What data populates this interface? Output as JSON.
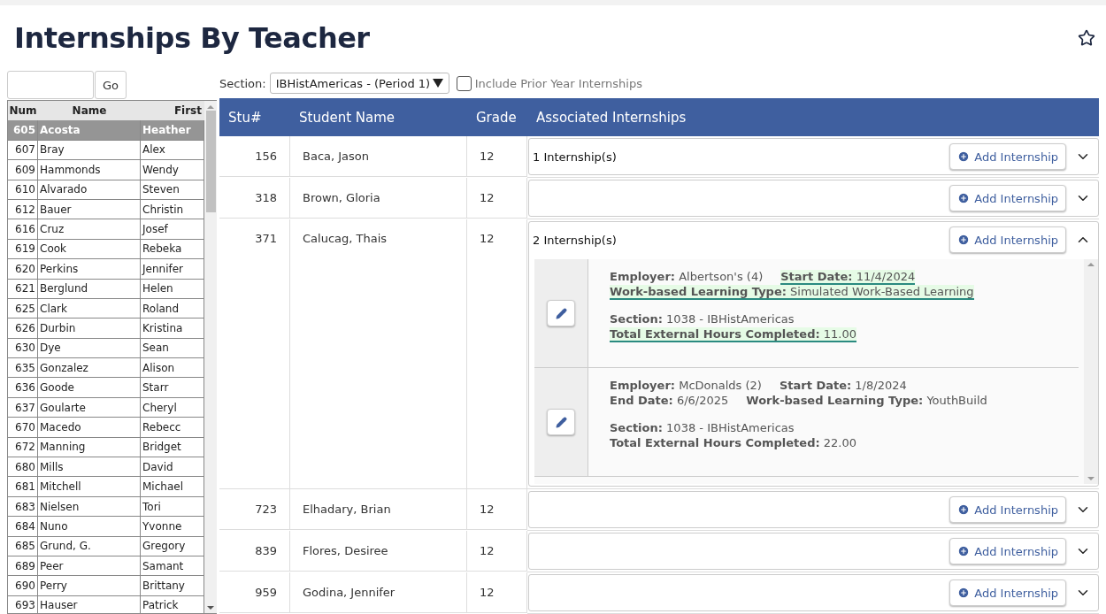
{
  "title": "Internships By Teacher",
  "favorite": false,
  "search": {
    "button": "Go"
  },
  "teacher_list": {
    "columns": [
      "Num",
      "Name",
      "First"
    ],
    "rows": [
      {
        "num": "605",
        "name": "Acosta",
        "first": "Heather",
        "selected": true
      },
      {
        "num": "607",
        "name": "Bray",
        "first": "Alex",
        "selected": false
      },
      {
        "num": "609",
        "name": "Hammonds",
        "first": "Wendy",
        "selected": false
      },
      {
        "num": "610",
        "name": "Alvarado",
        "first": "Steven",
        "selected": false
      },
      {
        "num": "612",
        "name": "Bauer",
        "first": "Christin",
        "selected": false
      },
      {
        "num": "616",
        "name": "Cruz",
        "first": "Josef",
        "selected": false
      },
      {
        "num": "619",
        "name": "Cook",
        "first": "Rebeka",
        "selected": false
      },
      {
        "num": "620",
        "name": "Perkins",
        "first": "Jennifer",
        "selected": false
      },
      {
        "num": "621",
        "name": "Berglund",
        "first": "Helen",
        "selected": false
      },
      {
        "num": "625",
        "name": "Clark",
        "first": "Roland",
        "selected": false
      },
      {
        "num": "626",
        "name": "Durbin",
        "first": "Kristina",
        "selected": false
      },
      {
        "num": "630",
        "name": "Dye",
        "first": "Sean",
        "selected": false
      },
      {
        "num": "635",
        "name": "Gonzalez",
        "first": "Alison",
        "selected": false
      },
      {
        "num": "636",
        "name": "Goode",
        "first": "Starr",
        "selected": false
      },
      {
        "num": "637",
        "name": "Goularte",
        "first": "Cheryl",
        "selected": false
      },
      {
        "num": "670",
        "name": "Macedo",
        "first": "Rebecc",
        "selected": false
      },
      {
        "num": "672",
        "name": "Manning",
        "first": "Bridget",
        "selected": false
      },
      {
        "num": "680",
        "name": "Mills",
        "first": "David",
        "selected": false
      },
      {
        "num": "681",
        "name": "Mitchell",
        "first": "Michael",
        "selected": false
      },
      {
        "num": "683",
        "name": "Nielsen",
        "first": "Tori",
        "selected": false
      },
      {
        "num": "684",
        "name": "Nuno",
        "first": "Yvonne",
        "selected": false
      },
      {
        "num": "685",
        "name": "Grund, G.",
        "first": "Gregory",
        "selected": false
      },
      {
        "num": "689",
        "name": "Peer",
        "first": "Samant",
        "selected": false
      },
      {
        "num": "690",
        "name": "Perry",
        "first": "Brittany",
        "selected": false
      },
      {
        "num": "693",
        "name": "Hauser",
        "first": "Patrick",
        "selected": false
      }
    ]
  },
  "section_filter": {
    "label": "Section:",
    "value": "IBHistAmericas - (Period 1)"
  },
  "prior_year": {
    "label": "Include Prior Year Internships",
    "checked": false
  },
  "students": {
    "columns": [
      "Stu#",
      "Student Name",
      "Grade",
      "Associated Internships"
    ],
    "rows": [
      {
        "num": "156",
        "name": "Baca, Jason",
        "grade": "12",
        "count": "1 Internship(s)",
        "add": "Add Internship",
        "expanded": false
      },
      {
        "num": "318",
        "name": "Brown, Gloria",
        "grade": "12",
        "add": "Add Internship",
        "expanded": false
      },
      {
        "num": "371",
        "name": "Calucag, Thais",
        "grade": "12",
        "count": "2 Internship(s)",
        "add": "Add Internship",
        "expanded": true,
        "internships": [
          {
            "groups": [
              [
                [
                  {
                    "label": "Employer:",
                    "value": "Albertson's (4)",
                    "highlighted": false
                  },
                  {
                    "label": "Start Date:",
                    "value": "11/4/2024",
                    "highlighted": true
                  }
                ],
                [
                  {
                    "label": "Work-based Learning Type:",
                    "value": "Simulated Work-Based Learning",
                    "highlighted": true
                  }
                ]
              ],
              [
                [
                  {
                    "label": "Section:",
                    "value": "1038 - IBHistAmericas",
                    "highlighted": false
                  }
                ],
                [
                  {
                    "label": "Total External Hours Completed:",
                    "value": "11.00",
                    "highlighted": true
                  }
                ]
              ]
            ]
          },
          {
            "groups": [
              [
                [
                  {
                    "label": "Employer:",
                    "value": "McDonalds (2)",
                    "highlighted": false
                  },
                  {
                    "label": "Start Date:",
                    "value": "1/8/2024",
                    "highlighted": false
                  }
                ],
                [
                  {
                    "label": "End Date:",
                    "value": "6/6/2025",
                    "highlighted": false
                  },
                  {
                    "label": "Work-based Learning Type:",
                    "value": "YouthBuild",
                    "highlighted": false
                  }
                ]
              ],
              [
                [
                  {
                    "label": "Section:",
                    "value": "1038 - IBHistAmericas",
                    "highlighted": false
                  }
                ],
                [
                  {
                    "label": "Total External Hours Completed:",
                    "value": "22.00",
                    "highlighted": false
                  }
                ]
              ]
            ]
          }
        ]
      },
      {
        "num": "723",
        "name": "Elhadary, Brian",
        "grade": "12",
        "add": "Add Internship",
        "expanded": false
      },
      {
        "num": "839",
        "name": "Flores, Desiree",
        "grade": "12",
        "add": "Add Internship",
        "expanded": false
      },
      {
        "num": "959",
        "name": "Godina, Jennifer",
        "grade": "12",
        "add": "Add Internship",
        "expanded": false
      }
    ]
  }
}
